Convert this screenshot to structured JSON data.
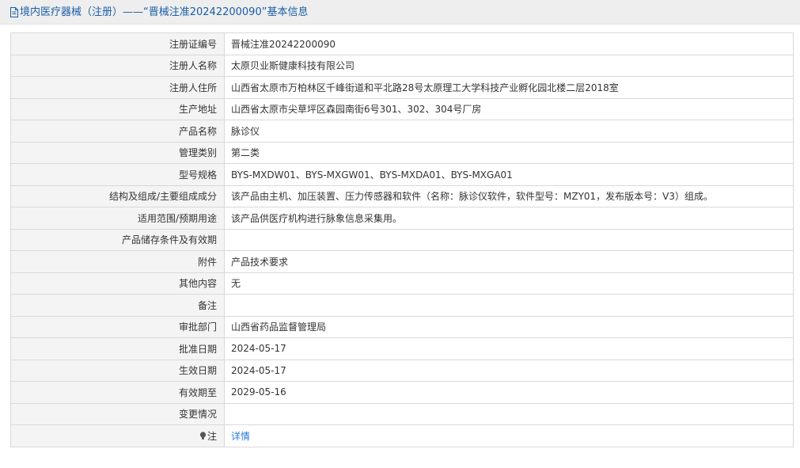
{
  "header": {
    "title": "境内医疗器械（注册）——“晋械注准20242200090”基本信息",
    "icon": "document-icon"
  },
  "rows": [
    {
      "label": "注册证编号",
      "value": "晋械注准20242200090"
    },
    {
      "label": "注册人名称",
      "value": "太原贝业斯健康科技有限公司"
    },
    {
      "label": "注册人住所",
      "value": "山西省太原市万柏林区千峰街道和平北路28号太原理工大学科技产业孵化园北楼二层2018室"
    },
    {
      "label": "生产地址",
      "value": "山西省太原市尖草坪区森园南街6号301、302、304号厂房"
    },
    {
      "label": "产品名称",
      "value": "脉诊仪"
    },
    {
      "label": "管理类别",
      "value": "第二类"
    },
    {
      "label": "型号规格",
      "value": "BYS-MXDW01、BYS-MXGW01、BYS-MXDA01、BYS-MXGA01"
    },
    {
      "label": "结构及组成/主要组成成分",
      "value": "该产品由主机、加压装置、压力传感器和软件（名称：脉诊仪软件，软件型号：MZY01，发布版本号：V3）组成。"
    },
    {
      "label": "适用范围/预期用途",
      "value": "该产品供医疗机构进行脉象信息采集用。"
    },
    {
      "label": "产品储存条件及有效期",
      "value": ""
    },
    {
      "label": "附件",
      "value": "产品技术要求"
    },
    {
      "label": "其他内容",
      "value": "无"
    },
    {
      "label": "备注",
      "value": ""
    },
    {
      "label": "审批部门",
      "value": "山西省药品监督管理局"
    },
    {
      "label": "批准日期",
      "value": "2024-05-17"
    },
    {
      "label": "生效日期",
      "value": "2024-05-17"
    },
    {
      "label": "有效期至",
      "value": "2029-05-16"
    },
    {
      "label": "变更情况",
      "value": ""
    }
  ],
  "note_row": {
    "label": "注",
    "value": "详情",
    "icon": "lightbulb-icon"
  },
  "colors": {
    "title": "#1a5ea8",
    "link": "#2a7bd4",
    "header_bg": "#eeeeee",
    "label_bg": "#f4f4f4"
  }
}
